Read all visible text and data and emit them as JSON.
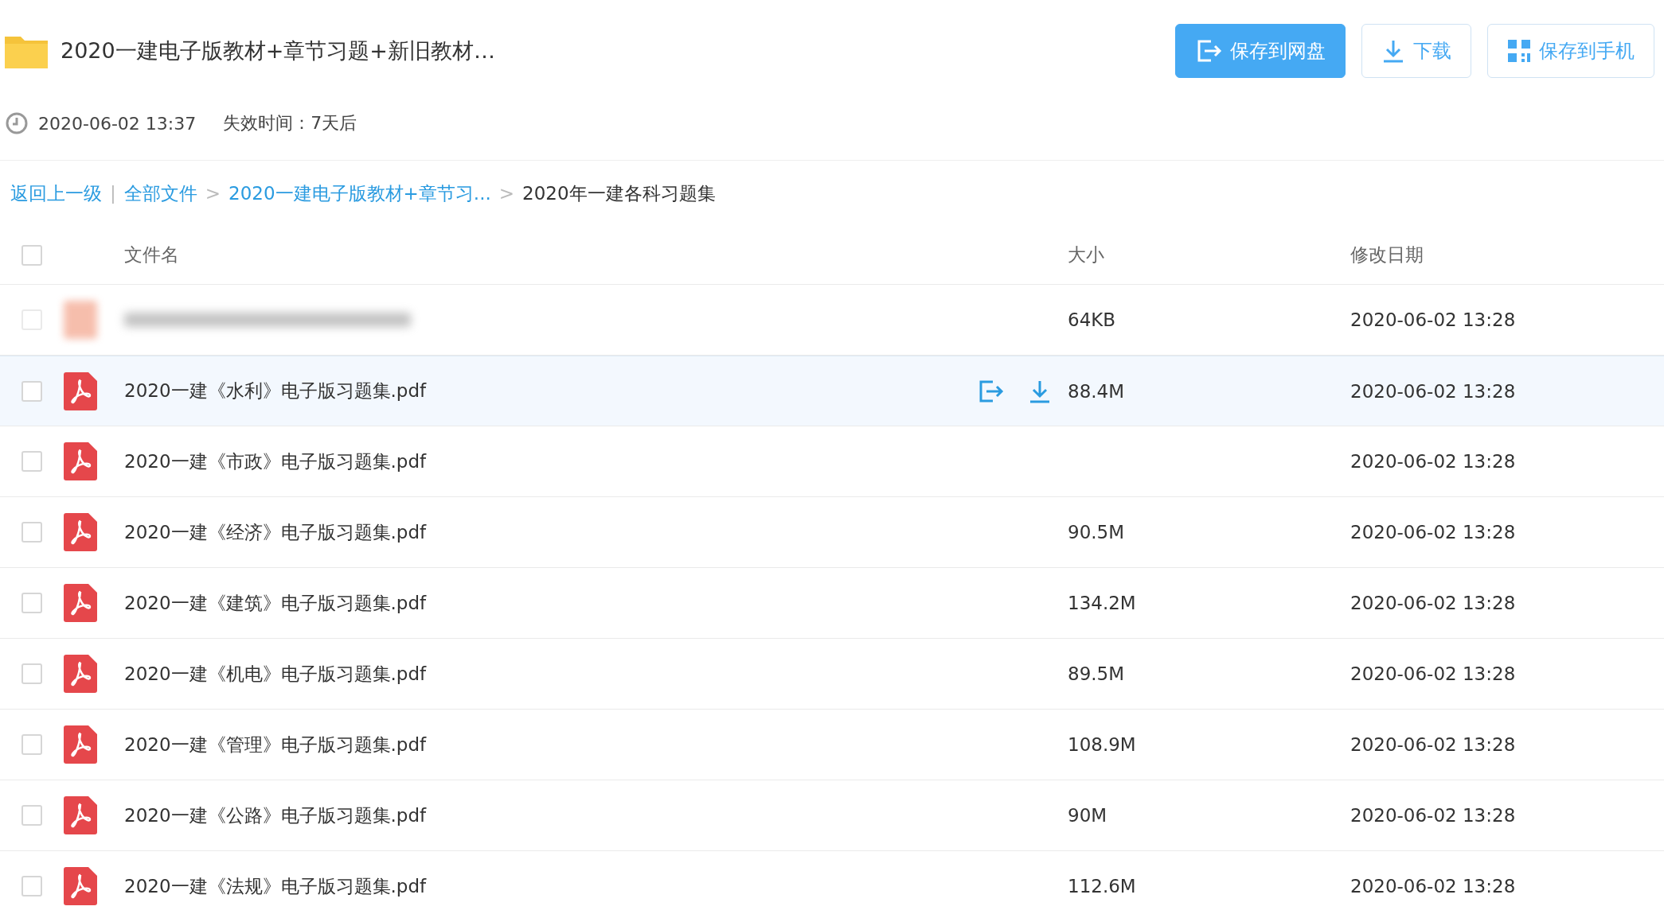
{
  "title": "2020一建电子版教材+章节习题+新旧教材…",
  "buttons": [
    {
      "label": "保存到网盘",
      "kind": "primary"
    },
    {
      "label": "下载",
      "kind": "download"
    },
    {
      "label": "保存到手机",
      "kind": "phone"
    }
  ],
  "created": "2020-06-02 13:37",
  "expiry": "失效时间：7天后",
  "breadcrumb": [
    {
      "label": "返回上一级",
      "kind": "link"
    },
    {
      "label": "|",
      "kind": "sep"
    },
    {
      "label": "全部文件",
      "kind": "link"
    },
    {
      "label": ">",
      "kind": "sep"
    },
    {
      "label": "2020一建电子版教材+章节习...",
      "kind": "link"
    },
    {
      "label": ">",
      "kind": "sep"
    },
    {
      "label": "2020年一建各科习题集",
      "kind": "current"
    }
  ],
  "table": {
    "checked": false,
    "columns": [
      "文件名",
      "大小",
      "修改日期"
    ],
    "rows": [
      {
        "kind": "blurred",
        "size": "64KB",
        "date": "2020-06-02 13:28",
        "checked": false,
        "highlighted": false
      },
      {
        "kind": "pdf",
        "name": "2020一建《水利》电子版习题集.pdf",
        "size": "88.4M",
        "date": "2020-06-02 13:28",
        "checked": false,
        "highlighted": true
      },
      {
        "kind": "pdf",
        "name": "2020一建《市政》电子版习题集.pdf",
        "date": "2020-06-02 13:28",
        "checked": false,
        "highlighted": false
      },
      {
        "kind": "pdf",
        "name": "2020一建《经济》电子版习题集.pdf",
        "size": "90.5M",
        "date": "2020-06-02 13:28",
        "checked": false,
        "highlighted": false
      },
      {
        "kind": "pdf",
        "name": "2020一建《建筑》电子版习题集.pdf",
        "size": "134.2M",
        "date": "2020-06-02 13:28",
        "checked": false,
        "highlighted": false
      },
      {
        "kind": "pdf",
        "name": "2020一建《机电》电子版习题集.pdf",
        "size": "89.5M",
        "date": "2020-06-02 13:28",
        "checked": false,
        "highlighted": false
      },
      {
        "kind": "pdf",
        "name": "2020一建《管理》电子版习题集.pdf",
        "size": "108.9M",
        "date": "2020-06-02 13:28",
        "checked": false,
        "highlighted": false
      },
      {
        "kind": "pdf",
        "name": "2020一建《公路》电子版习题集.pdf",
        "size": "90M",
        "date": "2020-06-02 13:28",
        "checked": false,
        "highlighted": false
      },
      {
        "kind": "pdf",
        "name": "2020一建《法规》电子版习题集.pdf",
        "size": "112.6M",
        "date": "2020-06-02 13:28",
        "checked": false,
        "highlighted": false
      }
    ]
  }
}
